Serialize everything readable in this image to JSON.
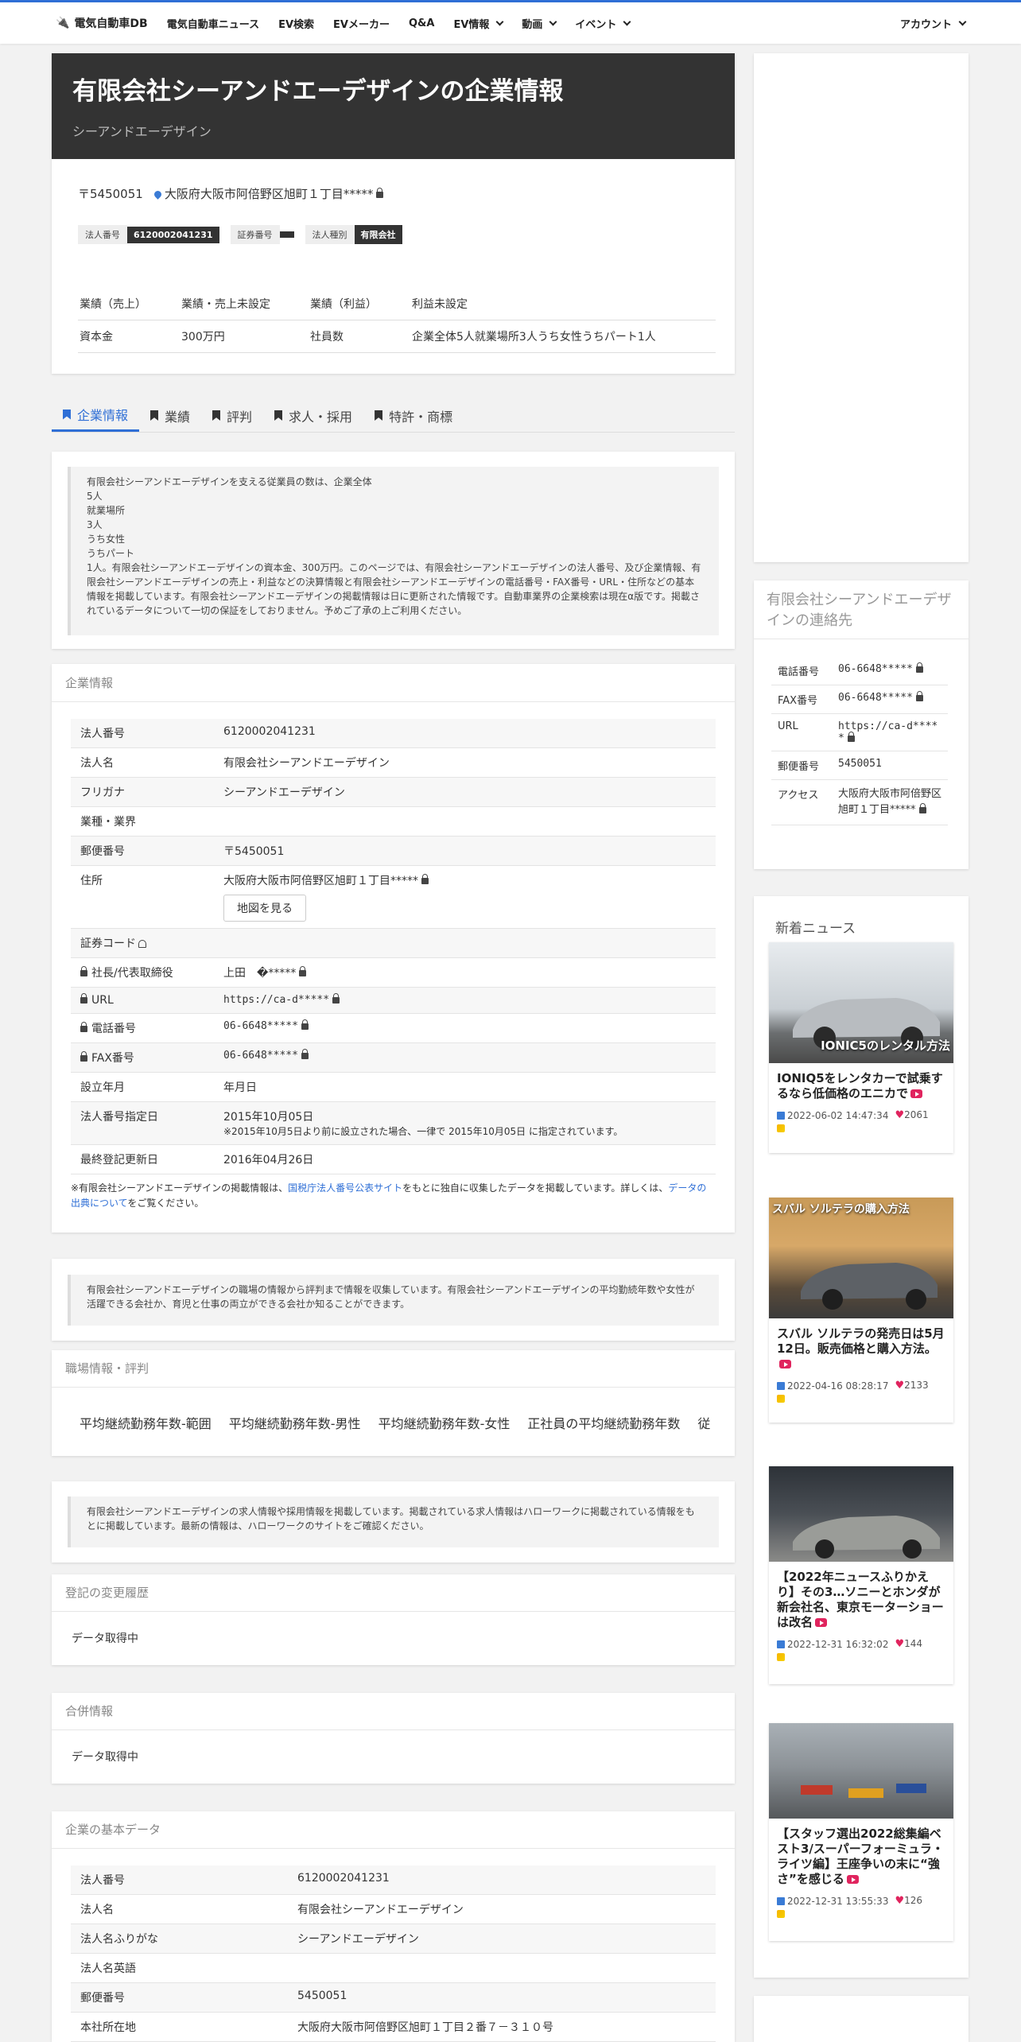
{
  "nav": {
    "brand": "電気自動車DB",
    "items": [
      "電気自動車ニュース",
      "EV検索",
      "EVメーカー",
      "Q&A"
    ],
    "dropdowns": [
      "EV情報",
      "動画",
      "イベント"
    ],
    "account": "アカウント"
  },
  "hero": {
    "title": "有限会社シーアンドエーデザインの企業情報",
    "subtitle": "シーアンドエーデザイン"
  },
  "summary": {
    "postal": "〒5450051",
    "address": "大阪府大阪市阿倍野区旭町１丁目*****",
    "tags": [
      {
        "label": "法人番号",
        "value": "6120002041231"
      },
      {
        "label": "証券番号",
        "value": ""
      },
      {
        "label": "法人種別",
        "value": "有限会社"
      }
    ],
    "rows": [
      [
        "業績（売上）",
        "業績・売上未設定",
        "業績（利益）",
        "利益未設定"
      ],
      [
        "資本金",
        "300万円",
        "社員数",
        "企業全体5人就業場所3人うち女性うちパート1人"
      ]
    ]
  },
  "tabs": [
    "企業情報",
    "業績",
    "評判",
    "求人・採用",
    "特許・商標"
  ],
  "intro": {
    "lines": [
      "有限会社シーアンドエーデザインを支える従業員の数は、企業全体",
      "5人",
      "就業場所",
      "3人",
      "うち女性",
      "うちパート"
    ],
    "paragraph": "1人。有限会社シーアンドエーデザインの資本金、300万円。このページでは、有限会社シーアンドエーデザインの法人番号、及び企業情報、有限会社シーアンドエーデザインの売上・利益などの決算情報と有限会社シーアンドエーデザインの電話番号・FAX番号・URL・住所などの基本情報を掲載しています。有限会社シーアンドエーデザインの掲載情報は日に更新された情報です。自動車業界の企業検索は現在α版です。掲載されているデータについて一切の保証をしておりません。予めご了承の上ご利用ください。"
  },
  "company_info": {
    "title": "企業情報",
    "rows": [
      {
        "k": "法人番号",
        "v": "6120002041231"
      },
      {
        "k": "法人名",
        "v": "有限会社シーアンドエーデザイン"
      },
      {
        "k": "フリガナ",
        "v": "シーアンドエーデザイン"
      },
      {
        "k": "業種・業界",
        "v": ""
      },
      {
        "k": "郵便番号",
        "v": "〒5450051"
      },
      {
        "k": "住所",
        "v": "大阪府大阪市阿倍野区旭町１丁目*****"
      },
      {
        "k": "証券コード",
        "v": ""
      },
      {
        "k": "社長/代表取締役",
        "v": "上田　�*****"
      },
      {
        "k": "URL",
        "v": "https://ca-d*****"
      },
      {
        "k": "電話番号",
        "v": "06-6648*****"
      },
      {
        "k": "FAX番号",
        "v": "06-6648*****"
      },
      {
        "k": "設立年月",
        "v": "年月日"
      },
      {
        "k": "法人番号指定日",
        "v": "2015年10月05日"
      },
      {
        "k": "最終登記更新日",
        "v": "2016年04月26日"
      }
    ],
    "map_button": "地図を見る",
    "designation_note": "※2015年10月5日より前に設立された場合、一律で 2015年10月05日 に指定されています。",
    "source_note_pre": "※有限会社シーアンドエーデザインの掲載情報は、",
    "source_link1": "国税庁法人番号公表サイト",
    "source_note_mid": "をもとに独自に収集したデータを掲載しています。詳しくは、",
    "source_link2": "データの出典について",
    "source_note_post": "をご覧ください。"
  },
  "workplace": {
    "intro": "有限会社シーアンドエーデザインの職場の情報から評判まで情報を収集しています。有限会社シーアンドエーデザインの平均勤続年数や女性が活躍できる会社か、育児と仕事の両立ができる会社か知ることができます。",
    "title": "職場情報・評判",
    "columns": [
      "平均継続勤務年数-範囲",
      "平均継続勤務年数-男性",
      "平均継続勤務年数-女性",
      "正社員の平均継続勤務年数",
      "従"
    ]
  },
  "recruit": {
    "intro": "有限会社シーアンドエーデザインの求人情報や採用情報を掲載しています。掲載されている求人情報はハローワークに掲載されている情報をもとに掲載しています。最新の情報は、ハローワークのサイトをご確認ください。"
  },
  "registry": {
    "title": "登記の変更履歴",
    "value": "データ取得中"
  },
  "merger": {
    "title": "合併情報",
    "value": "データ取得中"
  },
  "basic": {
    "title": "企業の基本データ",
    "rows": [
      {
        "k": "法人番号",
        "v": "6120002041231"
      },
      {
        "k": "法人名",
        "v": "有限会社シーアンドエーデザイン"
      },
      {
        "k": "法人名ふりがな",
        "v": "シーアンドエーデザイン"
      },
      {
        "k": "法人名英語",
        "v": ""
      },
      {
        "k": "郵便番号",
        "v": "5450051"
      },
      {
        "k": "本社所在地",
        "v": "大阪府大阪市阿倍野区旭町１丁目２番７－３１０号"
      }
    ]
  },
  "sidebar": {
    "contact_title": "有限会社シーアンドエーデザインの連絡先",
    "contact": [
      {
        "k": "電話番号",
        "v": "06-6648*****"
      },
      {
        "k": "FAX番号",
        "v": "06-6648*****"
      },
      {
        "k": "URL",
        "v": "https://ca-d*****"
      },
      {
        "k": "郵便番号",
        "v": "5450051"
      },
      {
        "k": "アクセス",
        "v": "大阪府大阪市阿倍野区旭町１丁目*****"
      }
    ],
    "news_title": "新着ニュース",
    "news": [
      {
        "caption": "IONIC5のレンタル方法",
        "title": "IONIQ5をレンタカーで試乗するなら低価格のエニカで",
        "date": "2022-06-02 14:47:34",
        "likes": "2061"
      },
      {
        "caption": "スバル ソルテラの購入方法",
        "title": "スバル ソルテラの発売日は5月12日。販売価格と購入方法。",
        "date": "2022-04-16 08:28:17",
        "likes": "2133"
      },
      {
        "caption": "",
        "title": "【2022年ニュースふりかえり】その3…ソニーとホンダが新会社名、東京モーターショーは改名",
        "date": "2022-12-31 16:32:02",
        "likes": "144"
      },
      {
        "caption": "",
        "title": "【スタッフ選出2022総集編ベスト3/スーパーフォーミュラ・ライツ編】王座争いの末に“強さ”を感じる",
        "date": "2022-12-31 13:55:33",
        "likes": "126"
      }
    ]
  }
}
